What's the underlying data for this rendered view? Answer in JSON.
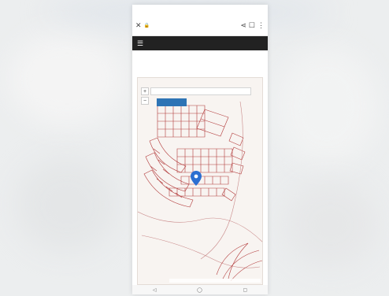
{
  "statusbar": {
    "time": "",
    "battery": ""
  },
  "browser": {
    "close_icon": "close-icon",
    "lock_icon": "lock-icon",
    "site_title": "",
    "site_url": "",
    "share_icon": "share-icon",
    "bookmark_icon": "bookmark-icon",
    "menu_icon": "more-vert-icon"
  },
  "navbar": {
    "menu_icon": "hamburger-icon"
  },
  "page": {
    "title": ""
  },
  "map": {
    "search_placeholder": "",
    "button_label": "",
    "zoom_in": "+",
    "zoom_out": "−",
    "brand": "",
    "copyright": "",
    "marker_color": "#2c6fd1",
    "parcel_color": "#b23a3a",
    "button_color": "#2e74b5"
  },
  "bottom_nav": {
    "back": "◁",
    "home": "◯",
    "recents": "▢"
  }
}
